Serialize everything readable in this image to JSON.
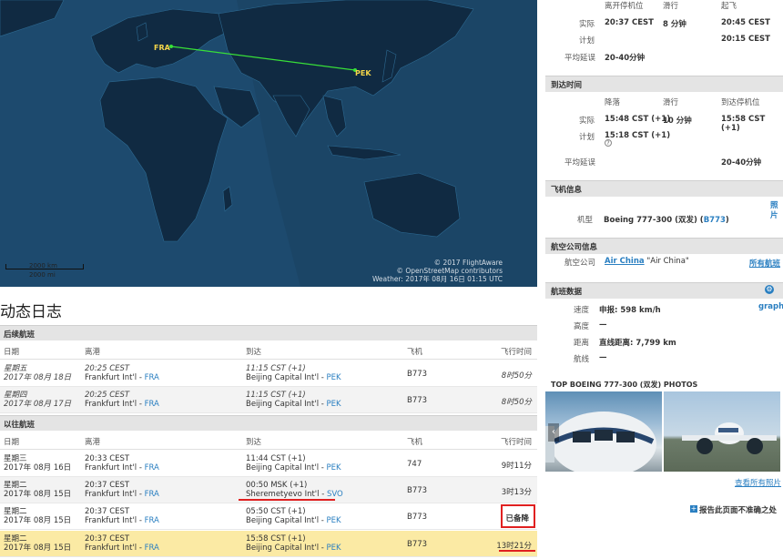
{
  "map": {
    "origin_code": "FRA",
    "dest_code": "PEK",
    "scale_km": "2000 km",
    "scale_mi": "2000 mi",
    "attribution": [
      "© 2017 FlightAware",
      "© OpenStreetMap contributors",
      "Weather: 2017年 08月 16日 01:15 UTC"
    ]
  },
  "log": {
    "title": "动态日志",
    "future_section": "后续航班",
    "past_section": "以往航班",
    "columns": {
      "date": "日期",
      "dep": "离港",
      "arr": "到达",
      "aircraft": "飞机",
      "duration": "飞行时间"
    },
    "future_rows": [
      {
        "weekday": "星期五",
        "date": "2017年 08月 18日",
        "dep_time": "20:25 CEST",
        "dep_airport": "Frankfurt Int'l - ",
        "dep_code": "FRA",
        "arr_time": "11:15 CST (+1)",
        "arr_airport": "Beijing Capital Int'l - ",
        "arr_code": "PEK",
        "aircraft": "B773",
        "duration": "8时50分"
      },
      {
        "weekday": "星期四",
        "date": "2017年 08月 17日",
        "dep_time": "20:25 CEST",
        "dep_airport": "Frankfurt Int'l - ",
        "dep_code": "FRA",
        "arr_time": "11:15 CST (+1)",
        "arr_airport": "Beijing Capital Int'l - ",
        "arr_code": "PEK",
        "aircraft": "B773",
        "duration": "8时50分"
      }
    ],
    "past_rows": [
      {
        "weekday": "星期三",
        "date": "2017年 08月 16日",
        "dep_time": "20:33 CEST",
        "dep_airport": "Frankfurt Int'l - ",
        "dep_code": "FRA",
        "arr_time": "11:44 CST (+1)",
        "arr_airport": "Beijing Capital Int'l - ",
        "arr_code": "PEK",
        "aircraft": "747",
        "duration": "9时11分"
      },
      {
        "weekday": "星期二",
        "date": "2017年 08月 15日",
        "dep_time": "20:37 CEST",
        "dep_airport": "Frankfurt Int'l - ",
        "dep_code": "FRA",
        "arr_time": "00:50 MSK (+1)",
        "arr_airport": "Sheremetyevo Int'l - ",
        "arr_code": "SVO",
        "aircraft": "B773",
        "duration": "3时13分"
      },
      {
        "weekday": "星期二",
        "date": "2017年 08月 15日",
        "dep_time": "20:37 CEST",
        "dep_airport": "Frankfurt Int'l - ",
        "dep_code": "FRA",
        "arr_time": "05:50 CST (+1)",
        "arr_airport": "Beijing Capital Int'l - ",
        "arr_code": "PEK",
        "aircraft": "B773",
        "duration": "已备降"
      },
      {
        "weekday": "星期二",
        "date": "2017年 08月 15日",
        "dep_time": "20:37 CEST",
        "dep_airport": "Frankfurt Int'l - ",
        "dep_code": "FRA",
        "arr_time": "15:58 CST (+1)",
        "arr_airport": "Beijing Capital Int'l - ",
        "arr_code": "PEK",
        "aircraft": "B773",
        "duration": "13时21分"
      }
    ]
  },
  "departure": {
    "col_gate": "离开停机位",
    "col_taxi": "滑行",
    "col_takeoff": "起飞",
    "actual_label": "实际",
    "actual_gate": "20:37 CEST",
    "actual_taxi": "8 分钟",
    "actual_takeoff": "20:45 CEST",
    "planned_label": "计划",
    "planned_takeoff": "20:15 CEST",
    "avg_delay_label": "平均延误",
    "avg_delay": "20-40分钟"
  },
  "arrival": {
    "section": "到达时间",
    "col_land": "降落",
    "col_taxi": "滑行",
    "col_gate": "到达停机位",
    "actual_label": "实际",
    "actual_land": "15:48 CST (+1)",
    "actual_taxi": "10 分钟",
    "actual_gate": "15:58 CST (+1)",
    "planned_label": "计划",
    "planned_land": "15:18 CST (+1)",
    "help_mark": "?",
    "avg_delay_label": "平均延误",
    "avg_delay": "20-40分钟"
  },
  "aircraft": {
    "section": "飞机信息",
    "type_label": "机型",
    "type_value": "Boeing 777-300 (双发) (",
    "type_code": "B773",
    "type_suffix": ")",
    "photo_link": "照片"
  },
  "airline": {
    "section": "航空公司信息",
    "label": "航空公司",
    "name": "Air China",
    "callsign": " \"Air China\"",
    "all_link": "所有航班"
  },
  "flight_data": {
    "section": "航班数据",
    "graph_link": "graph",
    "speed_label": "速度",
    "speed_value": "申报: 598 km/h",
    "alt_label": "高度",
    "alt_value": "—",
    "dist_label": "距离",
    "dist_value": "直线距离: 7,799 km",
    "route_label": "航线",
    "route_value": "—"
  },
  "photos": {
    "section": "TOP BOEING 777-300 (双发) PHOTOS",
    "see_all": "查看所有照片",
    "report": "报告此页面不准确之处"
  }
}
